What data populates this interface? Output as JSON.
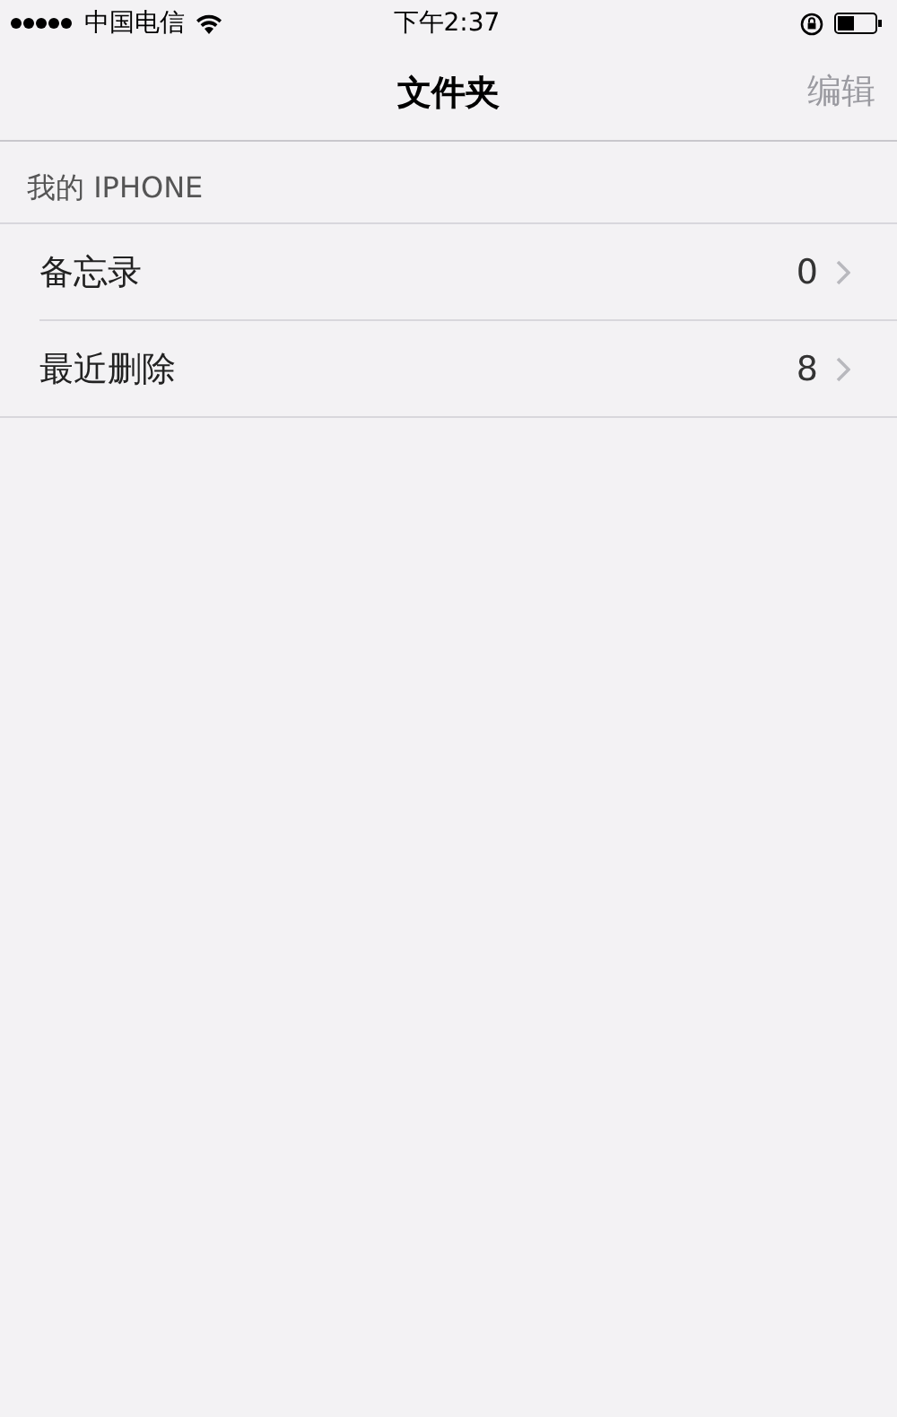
{
  "status_bar": {
    "carrier": "中国电信",
    "time": "下午2:37"
  },
  "nav": {
    "title": "文件夹",
    "edit": {
      "label": "编辑",
      "disabled": true
    }
  },
  "section": {
    "header": "我的 IPHONE",
    "rows": [
      {
        "name": "备忘录",
        "count": "0"
      },
      {
        "name": "最近删除",
        "count": "8"
      }
    ]
  }
}
